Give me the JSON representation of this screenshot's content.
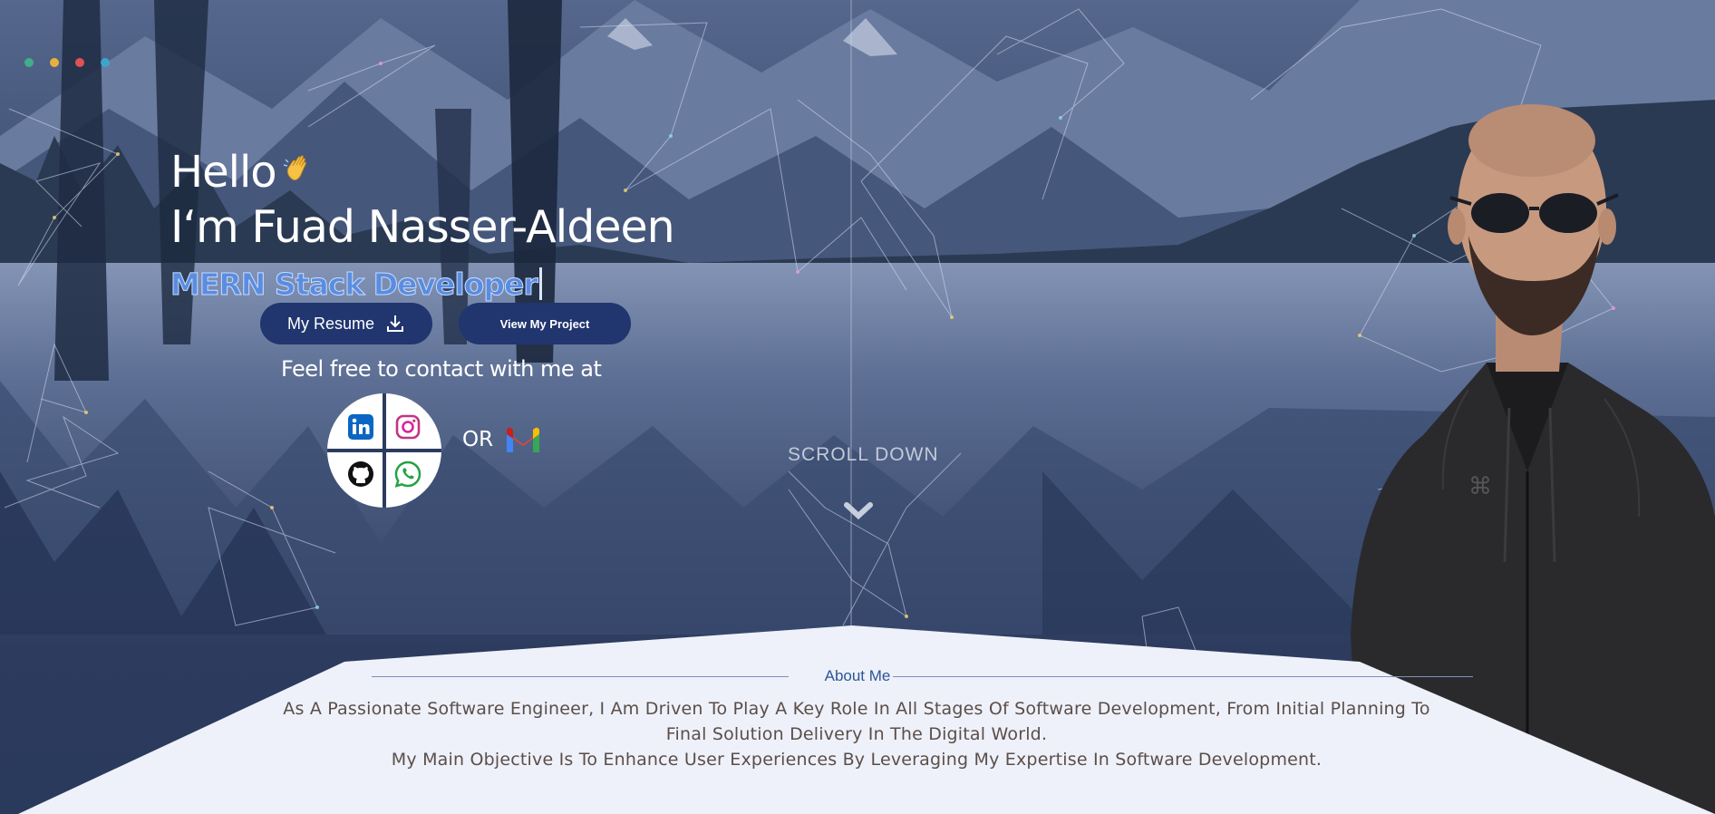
{
  "colors": {
    "accent": "#21356f",
    "role_text": "#5a8de0",
    "about_bg": "#eef1f9",
    "about_text": "#5b4e4a",
    "about_heading": "#2e5596",
    "dots": [
      "#3fae89",
      "#e6b13f",
      "#e05252",
      "#3aa6c9"
    ]
  },
  "hero": {
    "greeting": "Hello",
    "wave_icon": "waving-hand-icon",
    "name_line": "I‘m Fuad Nasser-Aldeen",
    "role": "MERN Stack Developer",
    "resume_button": "My Resume",
    "project_button": "View My Project",
    "contact_text": "Feel free to contact with me at",
    "or_text": "OR",
    "social_icons": [
      "linkedin-icon",
      "instagram-icon",
      "github-icon",
      "whatsapp-icon",
      "gmail-icon"
    ]
  },
  "scroll": {
    "label": "SCROLL DOWN",
    "icon": "chevron-down-icon"
  },
  "about": {
    "heading": "About Me",
    "paragraph_1": "As A Passionate Software Engineer, I Am Driven To Play A Key Role In All Stages Of Software Development, From Initial Planning To Final Solution Delivery In The Digital World.",
    "paragraph_2": "My Main Objective Is To Enhance User Experiences By Leveraging My Expertise In Software Development."
  }
}
